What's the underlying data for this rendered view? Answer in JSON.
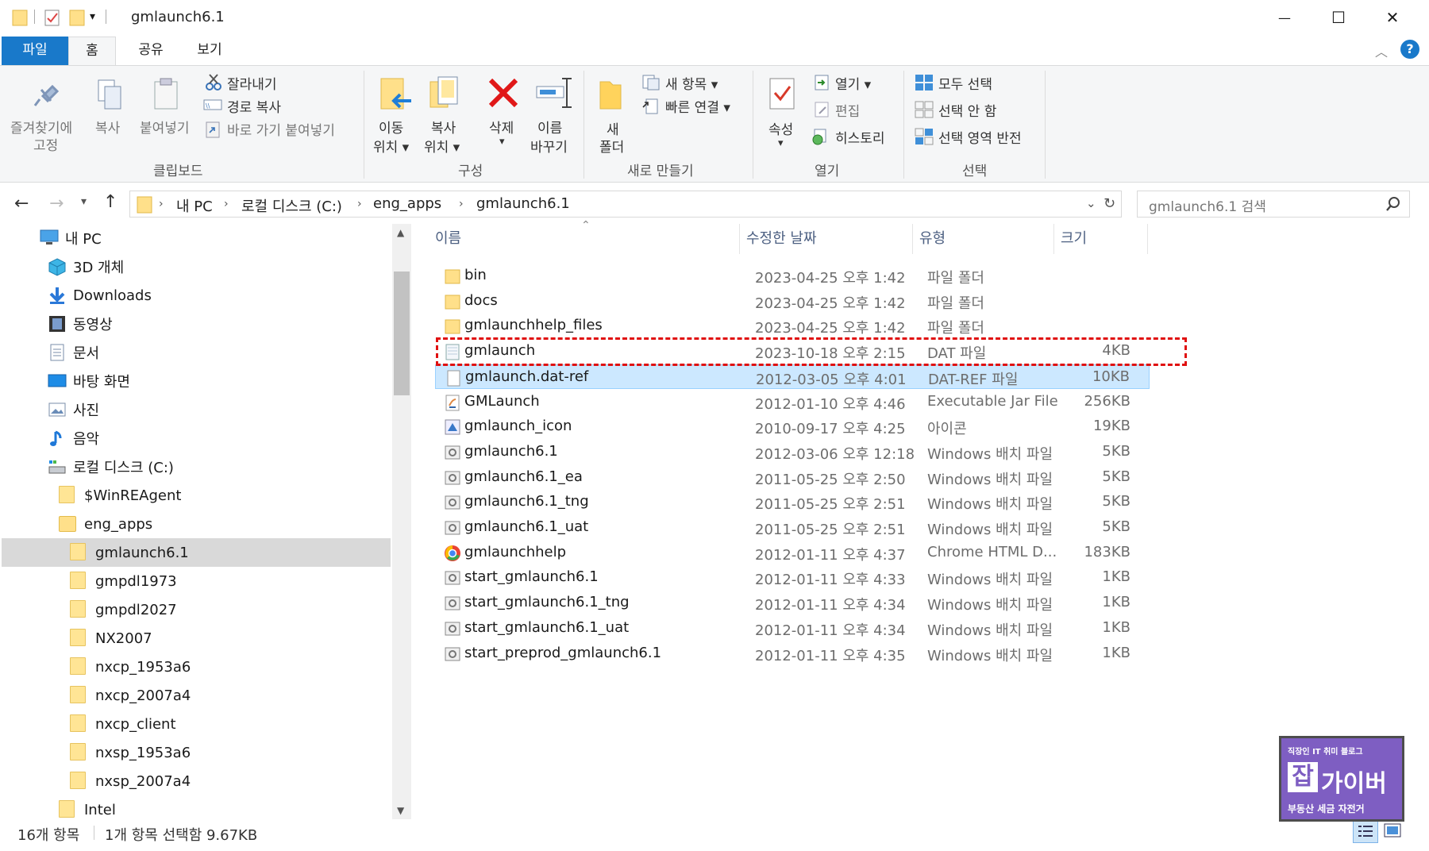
{
  "window": {
    "title": "gmlaunch6.1",
    "minimize": "—",
    "maximize": "☐",
    "close": "✕"
  },
  "tabs": {
    "file": "파일",
    "home": "홈",
    "share": "공유",
    "view": "보기"
  },
  "ribbon": {
    "clipboard": {
      "pin_line1": "즐겨찾기에",
      "pin_line2": "고정",
      "copy": "복사",
      "paste": "붙여넣기",
      "cut": "잘라내기",
      "copy_path": "경로 복사",
      "paste_shortcut": "바로 가기 붙여넣기",
      "group": "클립보드"
    },
    "organize": {
      "move_line1": "이동",
      "move_line2": "위치 ▾",
      "copyto_line1": "복사",
      "copyto_line2": "위치 ▾",
      "delete": "삭제",
      "delete_arrow": "▾",
      "rename_line1": "이름",
      "rename_line2": "바꾸기",
      "group": "구성"
    },
    "new": {
      "new_item": "새 항목 ▾",
      "easy_access": "빠른 연결 ▾",
      "folder_line1": "새",
      "folder_line2": "폴더",
      "group": "새로 만들기"
    },
    "open": {
      "properties": "속성",
      "properties_arrow": "▾",
      "open": "열기 ▾",
      "edit": "편집",
      "history": "히스토리",
      "group": "열기"
    },
    "select": {
      "select_all": "모두 선택",
      "select_none": "선택 안 함",
      "invert": "선택 영역 반전",
      "group": "선택"
    }
  },
  "address": {
    "crumbs": [
      "내 PC",
      "로컬 디스크 (C:)",
      "eng_apps",
      "gmlaunch6.1"
    ],
    "search_placeholder": "gmlaunch6.1 검색"
  },
  "nav": {
    "items": [
      {
        "label": "내 PC",
        "icon": "pc-icon"
      },
      {
        "label": "3D 개체",
        "icon": "cube-3d-icon"
      },
      {
        "label": "Downloads",
        "icon": "download-icon"
      },
      {
        "label": "동영상",
        "icon": "video-icon"
      },
      {
        "label": "문서",
        "icon": "document-icon"
      },
      {
        "label": "바탕 화면",
        "icon": "desktop-icon"
      },
      {
        "label": "사진",
        "icon": "pictures-icon"
      },
      {
        "label": "음악",
        "icon": "music-icon"
      },
      {
        "label": "로컬 디스크 (C:)",
        "icon": "drive-icon"
      },
      {
        "label": "$WinREAgent",
        "icon": "folder-icon"
      },
      {
        "label": "eng_apps",
        "icon": "folder-icon"
      },
      {
        "label": "gmlaunch6.1",
        "icon": "folder-icon"
      },
      {
        "label": "gmpdl1973",
        "icon": "folder-icon"
      },
      {
        "label": "gmpdl2027",
        "icon": "folder-icon"
      },
      {
        "label": "NX2007",
        "icon": "folder-icon"
      },
      {
        "label": "nxcp_1953a6",
        "icon": "folder-icon"
      },
      {
        "label": "nxcp_2007a4",
        "icon": "folder-icon"
      },
      {
        "label": "nxcp_client",
        "icon": "folder-icon"
      },
      {
        "label": "nxsp_1953a6",
        "icon": "folder-icon"
      },
      {
        "label": "nxsp_2007a4",
        "icon": "folder-icon"
      },
      {
        "label": "Intel",
        "icon": "folder-icon"
      }
    ]
  },
  "list": {
    "columns": {
      "name": "이름",
      "date": "수정한 날짜",
      "type": "유형",
      "size": "크기"
    },
    "rows": [
      {
        "name": "bin",
        "date": "2023-04-25 오후 1:42",
        "type": "파일 폴더",
        "size": "",
        "icon": "folder"
      },
      {
        "name": "docs",
        "date": "2023-04-25 오후 1:42",
        "type": "파일 폴더",
        "size": "",
        "icon": "folder"
      },
      {
        "name": "gmlaunchhelp_files",
        "date": "2023-04-25 오후 1:42",
        "type": "파일 폴더",
        "size": "",
        "icon": "folder"
      },
      {
        "name": "gmlaunch",
        "date": "2023-10-18 오후 2:15",
        "type": "DAT 파일",
        "size": "4KB",
        "icon": "dat"
      },
      {
        "name": "gmlaunch.dat-ref",
        "date": "2012-03-05 오후 4:01",
        "type": "DAT-REF 파일",
        "size": "10KB",
        "icon": "blank"
      },
      {
        "name": "GMLaunch",
        "date": "2012-01-10 오후 4:46",
        "type": "Executable Jar File",
        "size": "256KB",
        "icon": "jar"
      },
      {
        "name": "gmlaunch_icon",
        "date": "2010-09-17 오후 4:25",
        "type": "아이콘",
        "size": "19KB",
        "icon": "ico"
      },
      {
        "name": "gmlaunch6.1",
        "date": "2012-03-06 오후 12:18",
        "type": "Windows 배치 파일",
        "size": "5KB",
        "icon": "bat"
      },
      {
        "name": "gmlaunch6.1_ea",
        "date": "2011-05-25 오후 2:50",
        "type": "Windows 배치 파일",
        "size": "5KB",
        "icon": "bat"
      },
      {
        "name": "gmlaunch6.1_tng",
        "date": "2011-05-25 오후 2:51",
        "type": "Windows 배치 파일",
        "size": "5KB",
        "icon": "bat"
      },
      {
        "name": "gmlaunch6.1_uat",
        "date": "2011-05-25 오후 2:51",
        "type": "Windows 배치 파일",
        "size": "5KB",
        "icon": "bat"
      },
      {
        "name": "gmlaunchhelp",
        "date": "2012-01-11 오후 4:37",
        "type": "Chrome HTML D...",
        "size": "183KB",
        "icon": "chrome"
      },
      {
        "name": "start_gmlaunch6.1",
        "date": "2012-01-11 오후 4:33",
        "type": "Windows 배치 파일",
        "size": "1KB",
        "icon": "bat"
      },
      {
        "name": "start_gmlaunch6.1_tng",
        "date": "2012-01-11 오후 4:34",
        "type": "Windows 배치 파일",
        "size": "1KB",
        "icon": "bat"
      },
      {
        "name": "start_gmlaunch6.1_uat",
        "date": "2012-01-11 오후 4:34",
        "type": "Windows 배치 파일",
        "size": "1KB",
        "icon": "bat"
      },
      {
        "name": "start_preprod_gmlaunch6.1",
        "date": "2012-01-11 오후 4:35",
        "type": "Windows 배치 파일",
        "size": "1KB",
        "icon": "bat"
      }
    ]
  },
  "status": {
    "count": "16개 항목",
    "selection": "1개 항목 선택함 9.67KB"
  },
  "watermark": {
    "top": "직장인 IT 취미 블로그",
    "logo_big": "잡",
    "logo_text": "가이버",
    "bottom": "부동산 세금 자전거"
  },
  "colors": {
    "accent": "#1979ca",
    "selection": "#cce8ff",
    "annotation": "#e01010",
    "folder": "#ffe595",
    "watermark": "#7e5ec2"
  }
}
